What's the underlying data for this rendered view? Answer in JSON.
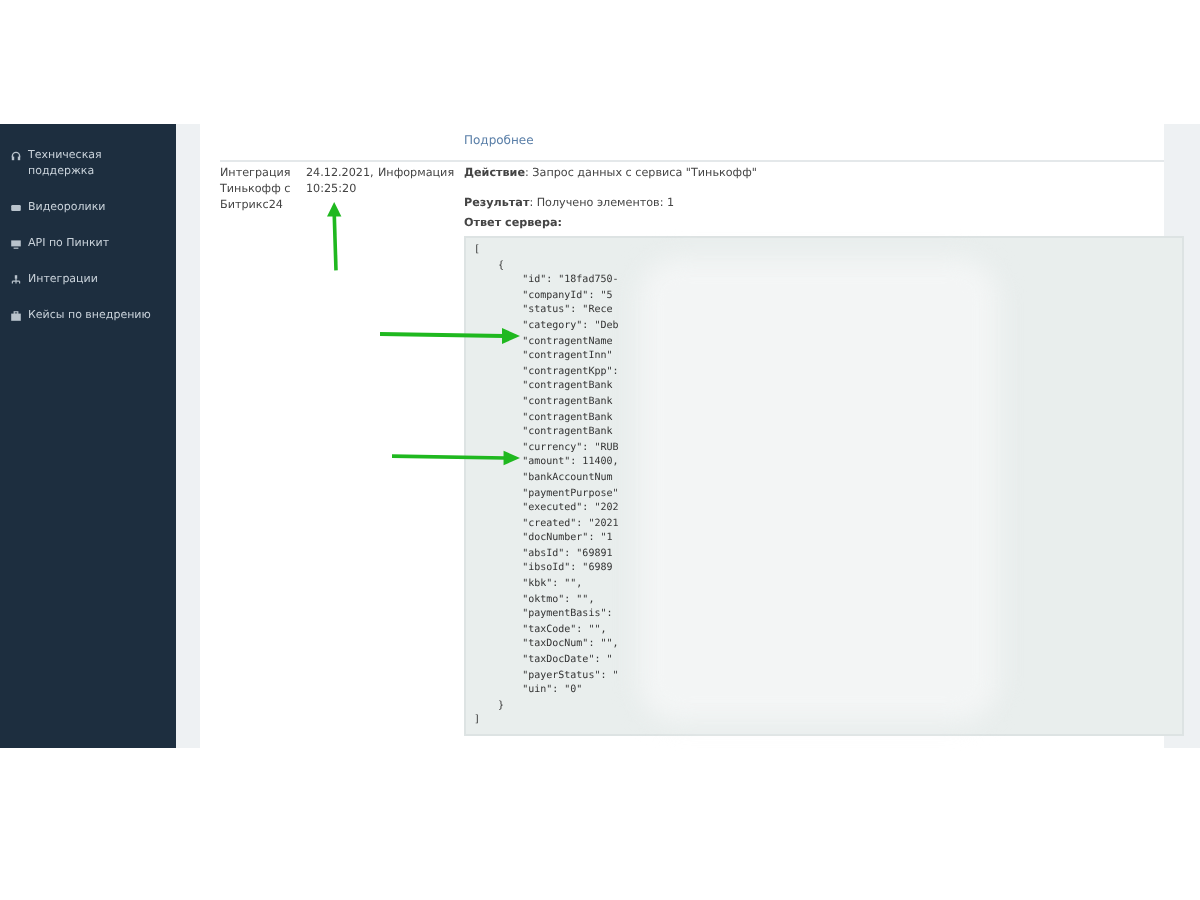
{
  "sidebar": {
    "items": [
      {
        "label": "Техническая поддержка",
        "kind": "headset"
      },
      {
        "label": "Видеоролики",
        "kind": "video"
      },
      {
        "label": "API по Пинкит",
        "kind": "api"
      },
      {
        "label": "Интеграции",
        "kind": "integration"
      },
      {
        "label": "Кейсы по внедрению",
        "kind": "case"
      }
    ]
  },
  "log": {
    "top_link": "Подробнее",
    "row": {
      "source": "Интеграция Тинькофф с Битрикс24",
      "date": "24.12.2021,",
      "time": "10:25:20",
      "level": "Информация",
      "action_label": "Действие",
      "action": ": Запрос данных с сервиса \"Тинькофф\"",
      "result_label": "Результат",
      "result": ": Получено элементов: 1",
      "response_label": "Ответ сервера:",
      "code": [
        "[",
        "    {",
        "        \"id\": \"18fad750-",
        "        \"companyId\": \"5",
        "        \"status\": \"Rece",
        "        \"category\": \"Deb",
        "        \"contragentName",
        "        \"contragentInn\"",
        "        \"contragentKpp\":",
        "        \"contragentBank",
        "        \"contragentBank",
        "        \"contragentBank",
        "        \"contragentBank",
        "        \"currency\": \"RUB",
        "        \"amount\": 11400,",
        "        \"bankAccountNum",
        "        \"paymentPurpose\"",
        "        \"executed\": \"202",
        "        \"created\": \"2021",
        "        \"docNumber\": \"1",
        "        \"absId\": \"69891",
        "        \"ibsoId\": \"6989",
        "        \"kbk\": \"\",",
        "        \"oktmo\": \"\",",
        "        \"paymentBasis\":",
        "        \"taxCode\": \"\",",
        "        \"taxDocNum\": \"\",",
        "        \"taxDocDate\": \"",
        "        \"payerStatus\": \"",
        "        \"uin\": \"0\"",
        "    }",
        "]"
      ]
    }
  }
}
